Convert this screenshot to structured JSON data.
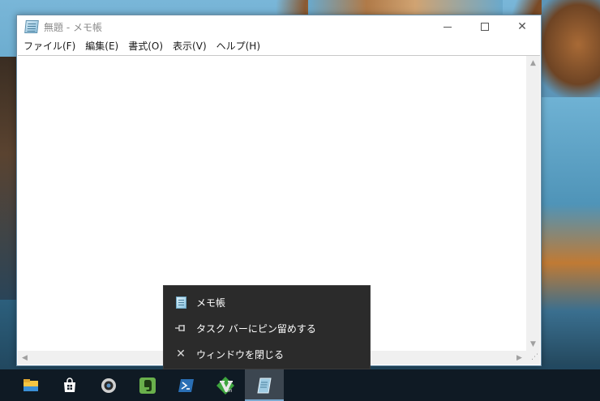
{
  "window": {
    "title": "無題 - メモ帳",
    "minimize_glyph": "—",
    "maximize_glyph": "☐",
    "close_glyph": "✕"
  },
  "menubar": {
    "items": [
      {
        "label": "ファイル(F)"
      },
      {
        "label": "編集(E)"
      },
      {
        "label": "書式(O)"
      },
      {
        "label": "表示(V)"
      },
      {
        "label": "ヘルプ(H)"
      }
    ]
  },
  "editor": {
    "content": ""
  },
  "scrollbars": {
    "up": "▲",
    "down": "▼",
    "left": "◀",
    "right": "▶"
  },
  "jumplist": {
    "items": [
      {
        "label": "メモ帳",
        "icon": "notepad-icon"
      },
      {
        "label": "タスク バーにピン留めする",
        "icon": "pin-icon",
        "glyph": "⊸"
      },
      {
        "label": "ウィンドウを閉じる",
        "icon": "close-icon",
        "glyph": "✕"
      }
    ]
  },
  "taskbar": {
    "items": [
      {
        "name": "file-explorer-icon",
        "color": "#f4c542"
      },
      {
        "name": "store-icon",
        "color": "#ffffff"
      },
      {
        "name": "camera-app-icon",
        "color": "#d0d0d0"
      },
      {
        "name": "evernote-icon",
        "color": "#6ab04c"
      },
      {
        "name": "powershell-icon",
        "color": "#2a6fb5"
      },
      {
        "name": "vim-icon",
        "color": "#3ea53e"
      },
      {
        "name": "notepad-icon",
        "color": "#9fcbe3",
        "active": true
      }
    ]
  },
  "colors": {
    "taskbar": "#0f1a24",
    "jumplist_bg": "#2b2b2b",
    "active_taskbar_item": "#3c4650"
  }
}
